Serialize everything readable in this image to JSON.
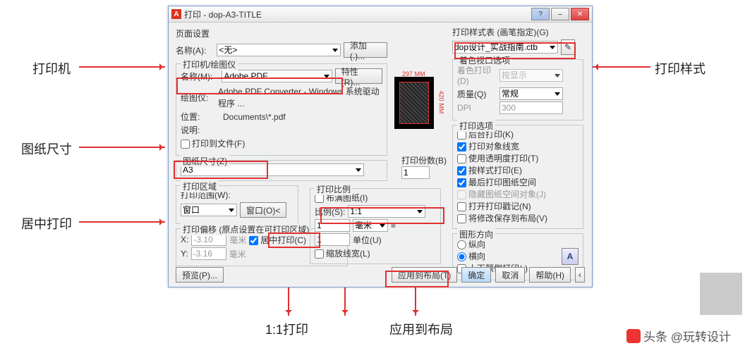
{
  "window": {
    "title": "打印 - dop-A3-TITLE"
  },
  "page_setup": {
    "heading": "页面设置",
    "name_label": "名称(A):",
    "name_value": "<无>",
    "add_btn": "添加(.)..."
  },
  "printer": {
    "heading": "打印机/绘图仪",
    "name_label": "名称(M):",
    "name_value": "Adobe PDF",
    "props_btn": "特性(R)...",
    "driver_label": "绘图仪:",
    "driver_value": "Adobe PDF Converter - Windows 系统驱动程序 ...",
    "location_label": "位置:",
    "location_value": "Documents\\*.pdf",
    "desc_label": "说明:",
    "tofile_label": "打印到文件(F)"
  },
  "paper": {
    "heading": "图纸尺寸(Z)",
    "value": "A3"
  },
  "copies": {
    "label": "打印份数(B)",
    "value": "1"
  },
  "area": {
    "heading": "打印区域",
    "what_label": "打印范围(W):",
    "what_value": "窗口",
    "pick_btn": "窗口(O)<"
  },
  "scale": {
    "heading": "打印比例",
    "fit_label": "布满图纸(I)",
    "ratio_label": "比例(S):",
    "ratio_value": "1:1",
    "num": "1",
    "unit": "毫米",
    "den": "1",
    "den_unit": "单位(U)",
    "lw_label": "缩放线宽(L)"
  },
  "offset": {
    "heading": "打印偏移 (原点设置在可打印区域)",
    "x_label": "X:",
    "x_value": "-3.10",
    "y_label": "Y:",
    "y_value": "-3.16",
    "unit": "毫米",
    "center_label": "居中打印(C)"
  },
  "styletable": {
    "heading": "打印样式表 (画笔指定)(G)",
    "value": "dop设计_实战指南.ctb"
  },
  "viewport": {
    "heading": "着色视口选项",
    "shade_label": "着色打印(D)",
    "shade_value": "按显示",
    "quality_label": "质量(Q)",
    "quality_value": "常规",
    "dpi_label": "DPI",
    "dpi_value": "300"
  },
  "options": {
    "heading": "打印选项",
    "bg": "后台打印(K)",
    "lw": "打印对象线宽",
    "transp": "使用透明度打印(T)",
    "styles": "按样式打印(E)",
    "paperspace_last": "最后打印图纸空间",
    "hide": "隐藏图纸空间对象(J)",
    "stamp": "打开打印戳记(N)",
    "save": "将修改保存到布局(V)"
  },
  "orient": {
    "heading": "图形方向",
    "portrait": "纵向",
    "landscape": "横向",
    "upside": "上下颠倒打印(-)"
  },
  "buttons": {
    "preview": "预览(P)...",
    "apply": "应用到布局(T)",
    "ok": "确定",
    "cancel": "取消",
    "help": "帮助(H)"
  },
  "preview_dims": {
    "w": "297 MM",
    "h": "420 MM"
  },
  "callouts": {
    "printer": "打印机",
    "paper": "图纸尺寸",
    "center": "居中打印",
    "ratio": "1:1打印",
    "apply": "应用到布局",
    "style": "打印样式"
  },
  "watermark": "头条 @玩转设计"
}
